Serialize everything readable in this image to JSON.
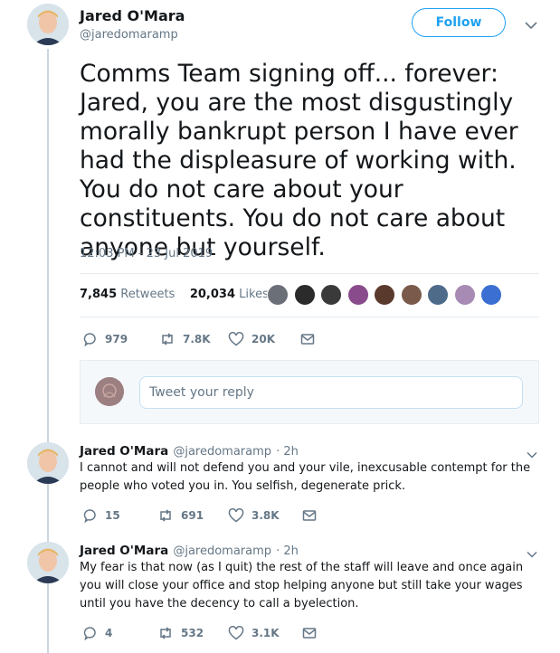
{
  "tweet": {
    "author_name": "Jared O'Mara",
    "author_handle": "@jaredomaramp",
    "follow_label": "Follow",
    "text": "Comms Team signing off... forever: Jared, you are the most disgustingly morally bankrupt person I have ever had the displeasure of working with. You do not care about your constituents. You do not care about anyone but yourself.",
    "timestamp": "12:03 PM - 23 Jul 2019",
    "retweets_count": "7,845",
    "retweets_label": "Retweets",
    "likes_count": "20,034",
    "likes_label": "Likes",
    "actions": {
      "replies": "979",
      "retweets": "7.8K",
      "likes": "20K"
    }
  },
  "liker_colors": [
    "#6b6f78",
    "#2b2b2b",
    "#3a3a3a",
    "#8a4b8c",
    "#5b3a2e",
    "#7a5a4a",
    "#4e6b8a",
    "#a88bb5",
    "#3b6fd1"
  ],
  "reply_box": {
    "placeholder": "Tweet your reply"
  },
  "replies": [
    {
      "name": "Jared O'Mara",
      "handle": "@jaredomaramp",
      "time": "· 2h",
      "text": "I cannot and will not defend you and your vile, inexcusable contempt for the people who voted you in. You selfish, degenerate prick.",
      "replies": "15",
      "retweets": "691",
      "likes": "3.8K"
    },
    {
      "name": "Jared O'Mara",
      "handle": "@jaredomaramp",
      "time": "· 2h",
      "text": "My fear is that now (as I quit) the rest of the staff will leave and once again you will close your office and stop helping anyone but still take your wages until you have the decency to call a byelection.",
      "replies": "4",
      "retweets": "532",
      "likes": "3.1K"
    }
  ],
  "colors": {
    "accent": "#1da1f2",
    "text": "#14171a",
    "muted": "#657786",
    "border": "#e6ecf0"
  }
}
